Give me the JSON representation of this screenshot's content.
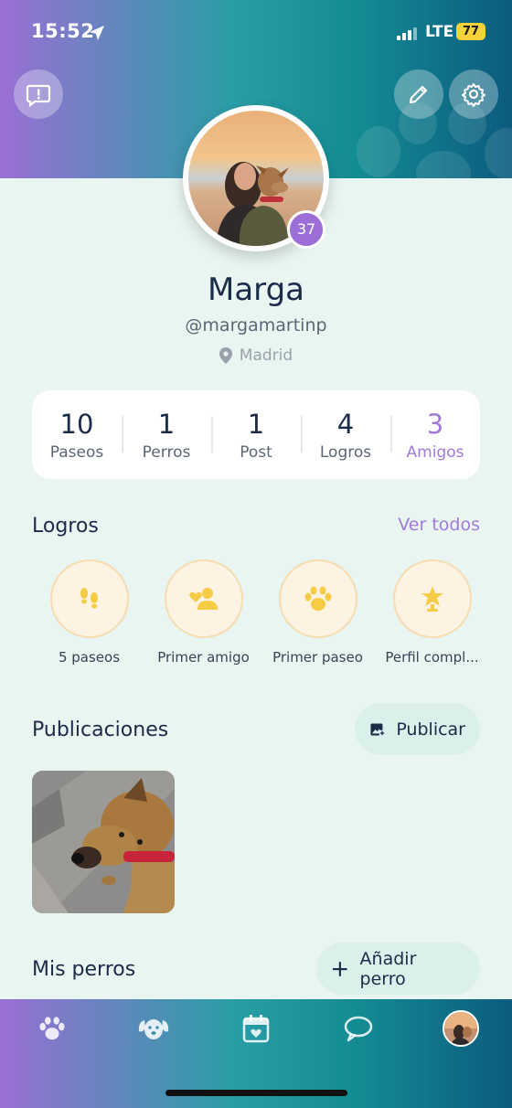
{
  "status_bar": {
    "time": "15:52",
    "network": "LTE",
    "battery": "77"
  },
  "profile": {
    "name": "Marga",
    "username": "@margamartinp",
    "location": "Madrid",
    "level": "37"
  },
  "stats": [
    {
      "value": "10",
      "label": "Paseos"
    },
    {
      "value": "1",
      "label": "Perros"
    },
    {
      "value": "1",
      "label": "Post"
    },
    {
      "value": "4",
      "label": "Logros"
    },
    {
      "value": "3",
      "label": "Amigos"
    }
  ],
  "achievements": {
    "title": "Logros",
    "see_all": "Ver todos",
    "items": [
      {
        "label": "5 paseos",
        "icon": "footprints-icon"
      },
      {
        "label": "Primer amigo",
        "icon": "friends-icon"
      },
      {
        "label": "Primer paseo",
        "icon": "paw-icon"
      },
      {
        "label": "Perfil compl...",
        "icon": "trophy-icon"
      }
    ]
  },
  "posts": {
    "title": "Publicaciones",
    "publish_label": "Publicar"
  },
  "dogs": {
    "title": "Mis perros",
    "add_label": "Añadir perro"
  },
  "nav": [
    "paw-icon",
    "dog-icon",
    "calendar-icon",
    "chat-icon",
    "profile-avatar"
  ],
  "colors": {
    "accent": "#a07ad6",
    "background": "#e9f5f0",
    "text": "#1c2b4a",
    "achievement_gold": "#f5cc44",
    "gradient": [
      "#9a6fd4",
      "#2a9ea6",
      "#0c5b7e"
    ]
  }
}
